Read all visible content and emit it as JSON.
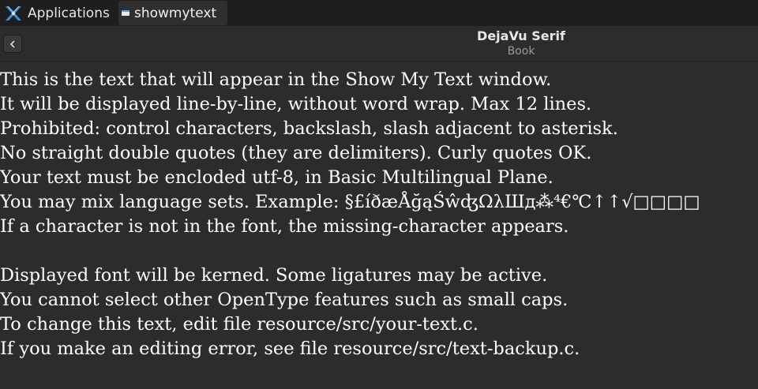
{
  "panel": {
    "apps_label": "Applications",
    "task_label": "showmytext",
    "apps_icon": "xfce-logo-icon",
    "task_icon": "window-icon"
  },
  "header": {
    "back_icon": "chevron-left-icon",
    "title": "DejaVu Serif",
    "subtitle": "Book"
  },
  "text_lines": [
    "This is the text that will appear in the Show My Text window.",
    "It will be displayed line-by-line, without word wrap. Max 12 lines.",
    "Prohibited: control characters, backslash, slash adjacent to asterisk.",
    "No straight double quotes (they are delimiters). Curly quotes OK.",
    "Your text must be encloded utf-8, in Basic Multilingual Plane.",
    "You may mix language sets. Example: §£íðæÅğąŚŵʤΩλШд⁂⁴€℃↑↑√□□□□",
    "If a character is not in the font, the missing-character appears.",
    "",
    "Displayed font will be kerned. Some ligatures may be active.",
    "You cannot select other OpenType features such as small caps.",
    "To change this text, edit file resource/src/your-text.c.",
    "If you make an editing error, see file resource/src/text-backup.c."
  ]
}
